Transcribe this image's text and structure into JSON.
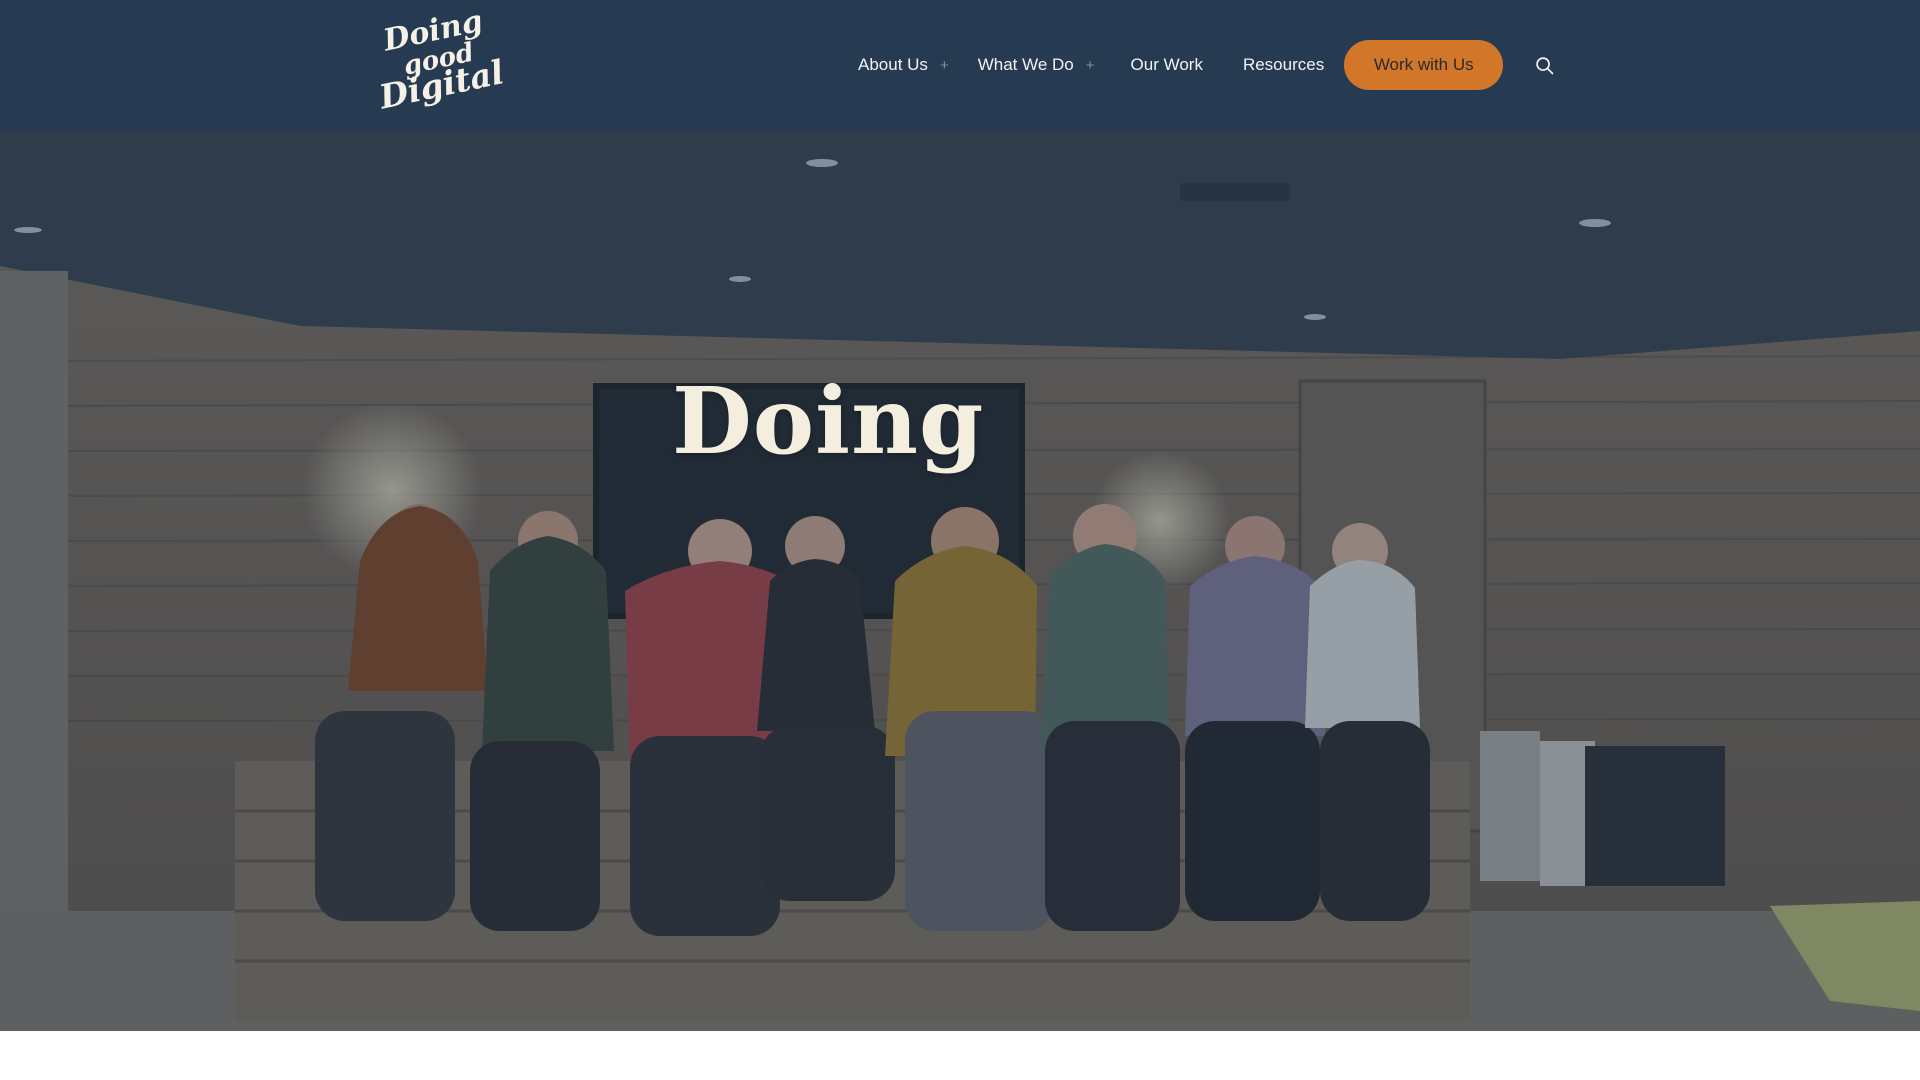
{
  "header": {
    "logo": {
      "line1": "Doing",
      "line2": "good",
      "line3": "Digital"
    },
    "nav": {
      "about": "About Us",
      "what_we_do": "What We Do",
      "our_work": "Our Work",
      "resources": "Resources",
      "expand_symbol": "+"
    },
    "cta_label": "Work with Us",
    "search_icon": "search-icon"
  },
  "hero": {
    "title": "Doing",
    "background_image": "team-photo"
  },
  "colors": {
    "header_bg": "#263b51",
    "cta_bg": "#d2772a",
    "hero_title": "#f3eedd",
    "nav_text": "#f2f2f2"
  }
}
